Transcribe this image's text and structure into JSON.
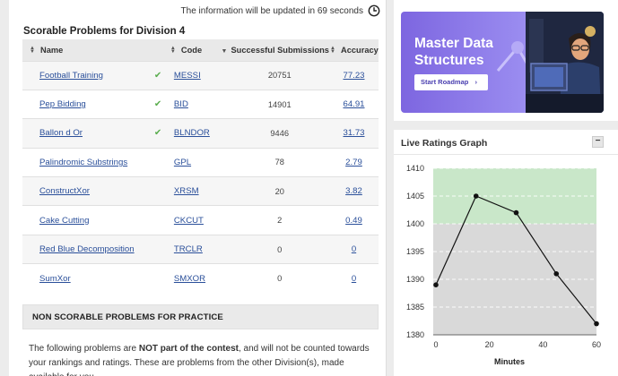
{
  "update_notice": "The information will be updated in 69 seconds",
  "section_title": "Scorable Problems for Division 4",
  "table": {
    "headers": {
      "name": "Name",
      "code": "Code",
      "submissions": "Successful Submissions",
      "accuracy": "Accuracy"
    },
    "rows": [
      {
        "name": "Football Training",
        "solved": true,
        "code": "MESSI",
        "submissions": "20751",
        "accuracy": "77.23"
      },
      {
        "name": "Pep Bidding",
        "solved": true,
        "code": "BID",
        "submissions": "14901",
        "accuracy": "64.91"
      },
      {
        "name": "Ballon d Or",
        "solved": true,
        "code": "BLNDOR",
        "submissions": "9446",
        "accuracy": "31.73"
      },
      {
        "name": "Palindromic Substrings",
        "solved": false,
        "code": "GPL",
        "submissions": "78",
        "accuracy": "2.79"
      },
      {
        "name": "ConstructXor",
        "solved": false,
        "code": "XRSM",
        "submissions": "20",
        "accuracy": "3.82"
      },
      {
        "name": "Cake Cutting",
        "solved": false,
        "code": "CKCUT",
        "submissions": "2",
        "accuracy": "0.49"
      },
      {
        "name": "Red Blue Decomposition",
        "solved": false,
        "code": "TRCLR",
        "submissions": "0",
        "accuracy": "0"
      },
      {
        "name": "SumXor",
        "solved": false,
        "code": "SMXOR",
        "submissions": "0",
        "accuracy": "0"
      }
    ]
  },
  "non_scorable": {
    "title": "NON SCORABLE PROBLEMS FOR PRACTICE",
    "text_before": "The following problems are ",
    "text_bold": "NOT part of the contest",
    "text_after": ", and will not be counted towards your rankings and ratings. These are problems from the other Division(s), made available for you"
  },
  "banner": {
    "title_line1": "Master Data",
    "title_line2": "Structures",
    "button_label": "Start Roadmap",
    "button_icon": "chevron-right-icon"
  },
  "ratings_panel": {
    "title": "Live Ratings Graph",
    "minimize_label": "−"
  },
  "colors": {
    "link": "#2a4f9a",
    "check": "#5aad4e",
    "banner_purple": "#7d66e0",
    "graph_green_band": "#c9e7c9",
    "graph_gray_band": "#d9d9d9"
  },
  "chart_data": {
    "type": "line",
    "xlabel": "Minutes",
    "ylabel": "",
    "x_ticks": [
      0,
      20,
      40,
      60
    ],
    "y_ticks": [
      1380,
      1385,
      1390,
      1395,
      1400,
      1405,
      1410
    ],
    "xlim": [
      -1,
      60
    ],
    "ylim": [
      1380,
      1410
    ],
    "bands": [
      {
        "from": 1400,
        "to": 1410,
        "color": "#c9e7c9"
      },
      {
        "from": 1380,
        "to": 1400,
        "color": "#d9d9d9"
      }
    ],
    "series": [
      {
        "x": [
          0,
          15,
          30,
          45,
          60
        ],
        "y": [
          1389,
          1405,
          1402,
          1391,
          1382
        ]
      }
    ]
  }
}
